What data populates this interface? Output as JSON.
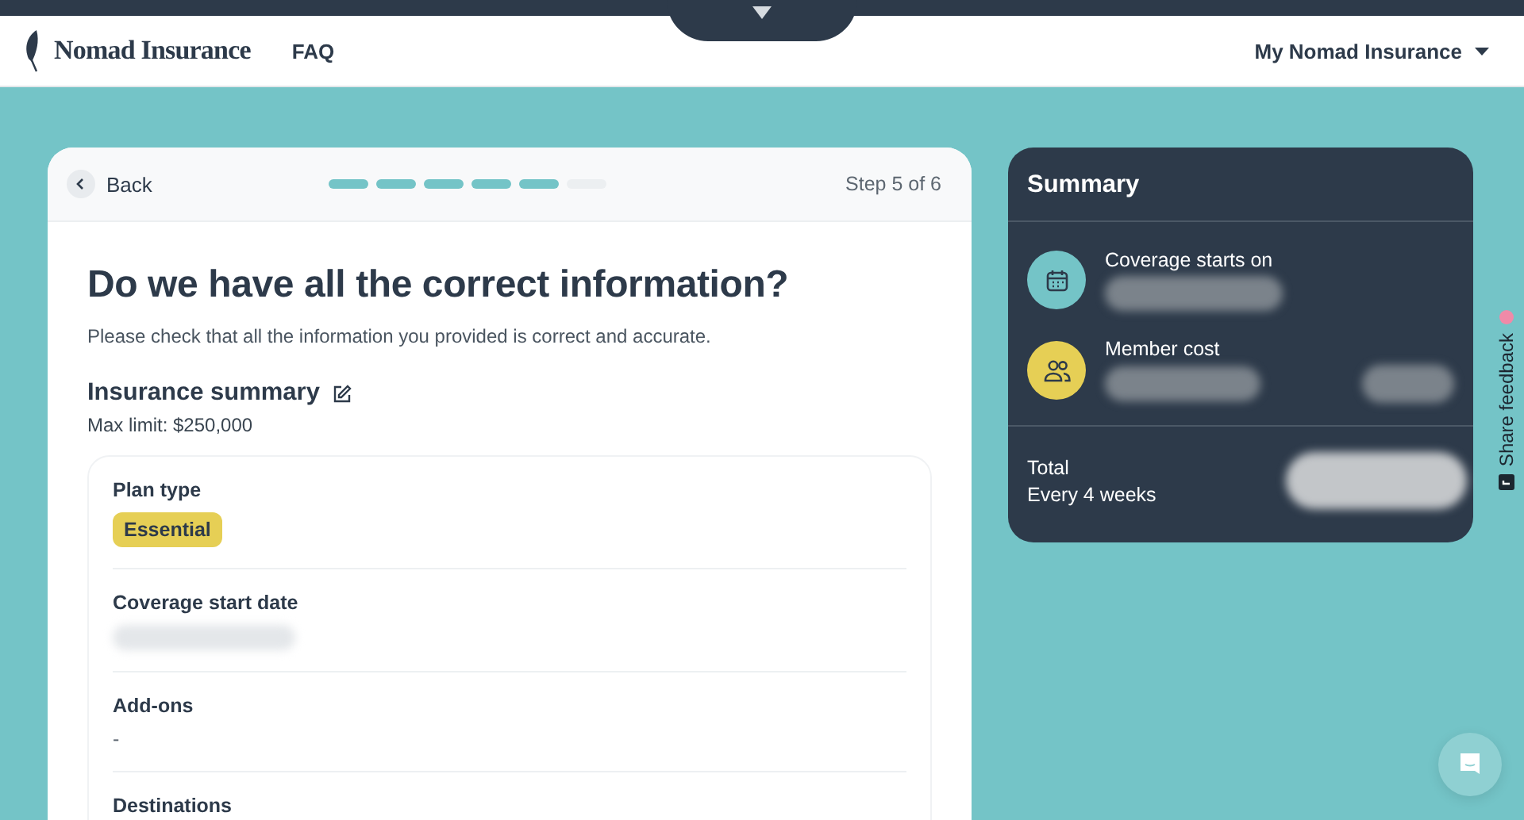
{
  "header": {
    "brand": "Nomad Insurance",
    "nav": [
      "FAQ"
    ],
    "account_menu": "My Nomad Insurance"
  },
  "steps_card": {
    "back": "Back",
    "steps": [
      {
        "done": true
      },
      {
        "done": true
      },
      {
        "done": true
      },
      {
        "done": true
      },
      {
        "done": true
      },
      {
        "done": false
      }
    ],
    "step_label": "Step 5 of 6"
  },
  "review": {
    "title": "Do we have all the correct information?",
    "subtitle": "Please check that all the information you provided is correct and accurate.",
    "section_title": "Insurance summary",
    "max_limit": "Max limit: $250,000",
    "fields": [
      {
        "label": "Plan type",
        "kind": "tag",
        "value": "Essential"
      },
      {
        "label": "Coverage start date",
        "kind": "redacted"
      },
      {
        "label": "Add-ons",
        "kind": "text",
        "value": "-"
      },
      {
        "label": "Destinations",
        "kind": "text"
      }
    ]
  },
  "summary": {
    "title": "Summary",
    "items": [
      {
        "label": "Coverage starts on",
        "kind": "calendar",
        "color": "#74c4c7",
        "extra_redacted": false
      },
      {
        "label": "Member cost",
        "kind": "members",
        "color": "#e6cf55",
        "extra_redacted": true
      }
    ],
    "total_label": "Total",
    "total_period": "Every 4 weeks"
  },
  "feedback_tab": {
    "label": "Share feedback"
  }
}
